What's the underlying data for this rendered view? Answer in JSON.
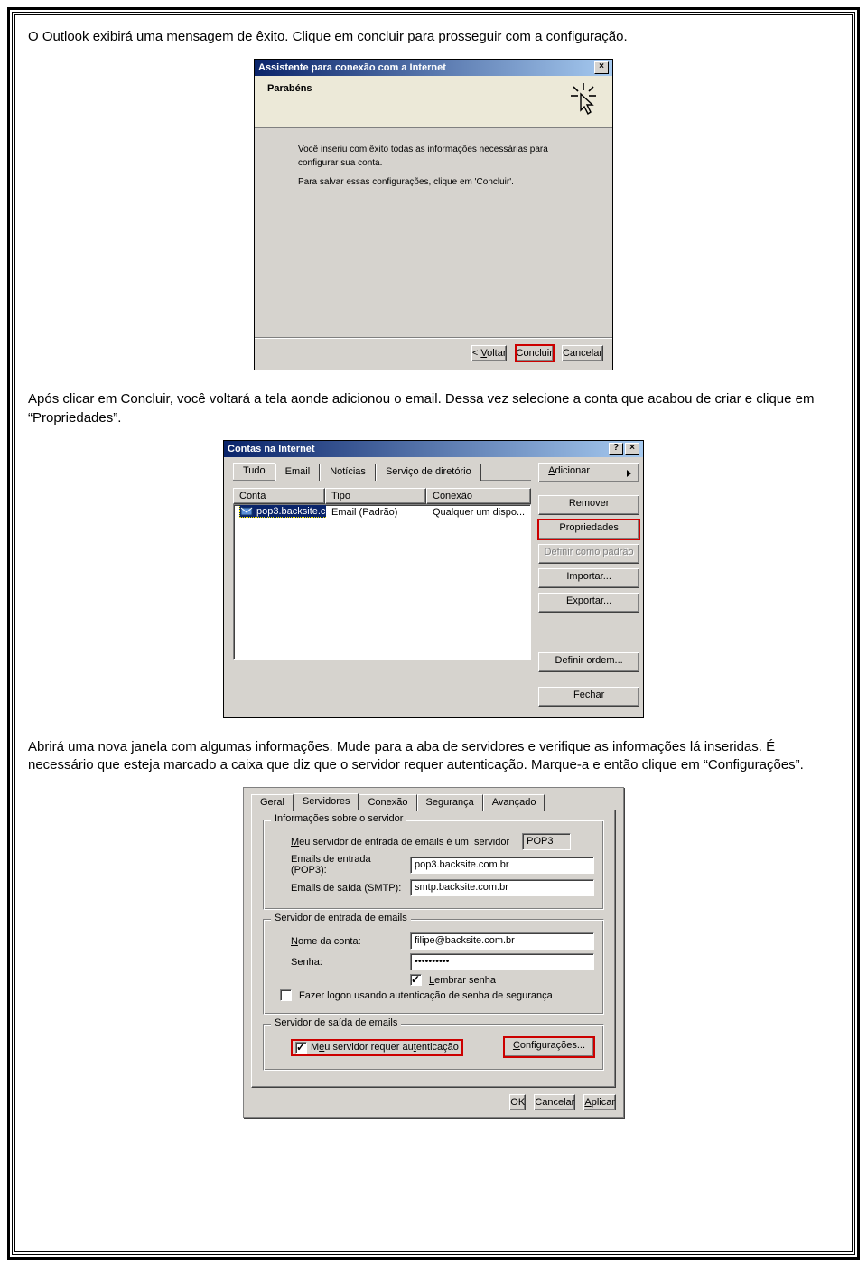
{
  "para1": "O Outlook exibirá uma mensagem de êxito. Clique em concluir para prosseguir com a configuração.",
  "para2": "Após clicar em Concluir, você voltará a tela aonde adicionou o email. Dessa vez selecione a conta que acabou de criar e clique em “Propriedades”.",
  "para3": "Abrirá uma nova janela com algumas informações. Mude para a aba de servidores e verifique as informações lá inseridas. É necessário que esteja marcado a caixa que diz que o servidor requer autenticação. Marque-a e então clique em “Configurações”.",
  "dlg1": {
    "title": "Assistente para conexão com a Internet",
    "close": "×",
    "head": "Parabéns",
    "line1": "Você inseriu com êxito todas as informações necessárias para configurar sua conta.",
    "line2": "Para salvar essas configurações, clique em 'Concluir'.",
    "back": "< Voltar",
    "finish": "Concluir",
    "cancel": "Cancelar"
  },
  "dlg2": {
    "title": "Contas na Internet",
    "help": "?",
    "close": "×",
    "tabs": {
      "tudo": "Tudo",
      "email": "Email",
      "noticias": "Notícias",
      "servico": "Serviço de diretório"
    },
    "cols": {
      "conta": "Conta",
      "tipo": "Tipo",
      "conexao": "Conexão"
    },
    "row": {
      "conta": "pop3.backsite.c...",
      "tipo": "Email (Padrão)",
      "conexao": "Qualquer um dispo..."
    },
    "adicionar": "Adicionar",
    "remover": "Remover",
    "propriedades": "Propriedades",
    "definir_padrao": "Definir como padrão",
    "importar": "Importar...",
    "exportar": "Exportar...",
    "definir_ordem": "Definir ordem...",
    "fechar": "Fechar"
  },
  "dlg3": {
    "tabs": {
      "geral": "Geral",
      "servidores": "Servidores",
      "conexao": "Conexão",
      "seguranca": "Segurança",
      "avancado": "Avançado"
    },
    "grp1": "Informações sobre o servidor",
    "lbl_intro_a": "Meu servidor de entrada de emails é um  servidor",
    "val_proto": "POP3",
    "lbl_pop": "Emails de entrada (POP3):",
    "val_pop": "pop3.backsite.com.br",
    "lbl_smtp": "Emails de saída (SMTP):",
    "val_smtp": "smtp.backsite.com.br",
    "grp2": "Servidor de entrada de emails",
    "lbl_nome": "Nome da conta:",
    "val_nome": "filipe@backsite.com.br",
    "lbl_senha": "Senha:",
    "val_senha": "••••••••••",
    "lembrar": "Lembrar senha",
    "spa": "Fazer logon usando autenticação de senha de segurança",
    "grp3": "Servidor de saída de emails",
    "requer": "Meu servidor requer autenticação",
    "config": "Configurações...",
    "ok": "OK",
    "cancel": "Cancelar",
    "aplicar": "Aplicar"
  }
}
